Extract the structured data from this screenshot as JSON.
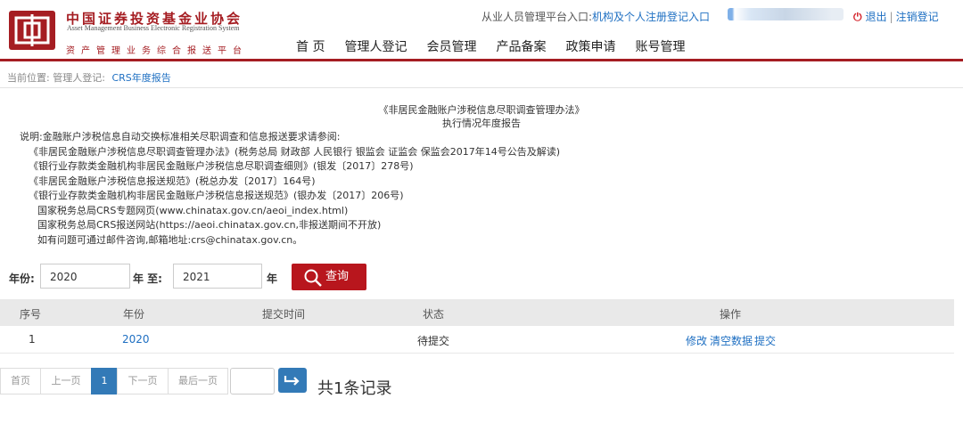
{
  "header": {
    "org_cn": "中国证券投资基金业协会",
    "org_en_1": "Asset Management Business Electronic Registration System",
    "org_sub": "资产管理业务综合报送平台",
    "nav": [
      "首 页",
      "管理人登记",
      "会员管理",
      "产品备案",
      "政策申请",
      "账号管理"
    ],
    "entry_label": "从业人员管理平台入口:",
    "entry_link": "机构及个人注册登记入口",
    "logout": "退出",
    "sep": "|",
    "cancel": "注销登记",
    "brand_color": "#a51d22"
  },
  "breadcrumb": {
    "label": "当前位置:",
    "parent": "管理人登记:",
    "current": "CRS年度报告"
  },
  "report": {
    "title1": "《非居民金融账户涉税信息尽职调查管理办法》",
    "title2": "执行情况年度报告",
    "notes": [
      "说明:金融账户涉税信息自动交换标准相关尽职调查和信息报送要求请参阅:",
      "《非居民金融账户涉税信息尽职调查管理办法》(税务总局 财政部 人民银行 银监会 证监会 保监会2017年14号公告及解读)",
      "《银行业存款类金融机构非居民金融账户涉税信息尽职调查细则》(银发〔2017〕278号)",
      "《非居民金融账户涉税信息报送规范》(税总办发〔2017〕164号)",
      "《银行业存款类金融机构非居民金融账户涉税信息报送规范》(银办发〔2017〕206号)",
      "国家税务总局CRS专题网页(www.chinatax.gov.cn/aeoi_index.html)",
      "国家税务总局CRS报送网站(https://aeoi.chinatax.gov.cn,非报送期间不开放)",
      "如有问题可通过邮件咨询,邮箱地址:crs@chinatax.gov.cn。"
    ]
  },
  "filter": {
    "year_label": "年份:",
    "from_value": "2020",
    "to_label": "年 至:",
    "to_value": "2021",
    "year_suffix": "年",
    "search_label": "查询"
  },
  "table": {
    "headers": [
      "序号",
      "年份",
      "提交时间",
      "状态",
      "操作"
    ],
    "rows": [
      {
        "index": "1",
        "year": "2020",
        "submit_time": "",
        "status": "待提交",
        "actions": [
          "修改",
          "清空数据",
          "提交"
        ]
      }
    ]
  },
  "pager": {
    "first": "首页",
    "prev": "上一页",
    "current": "1",
    "next": "下一页",
    "last": "最后一页",
    "page_input": "",
    "total": "共1条记录"
  }
}
